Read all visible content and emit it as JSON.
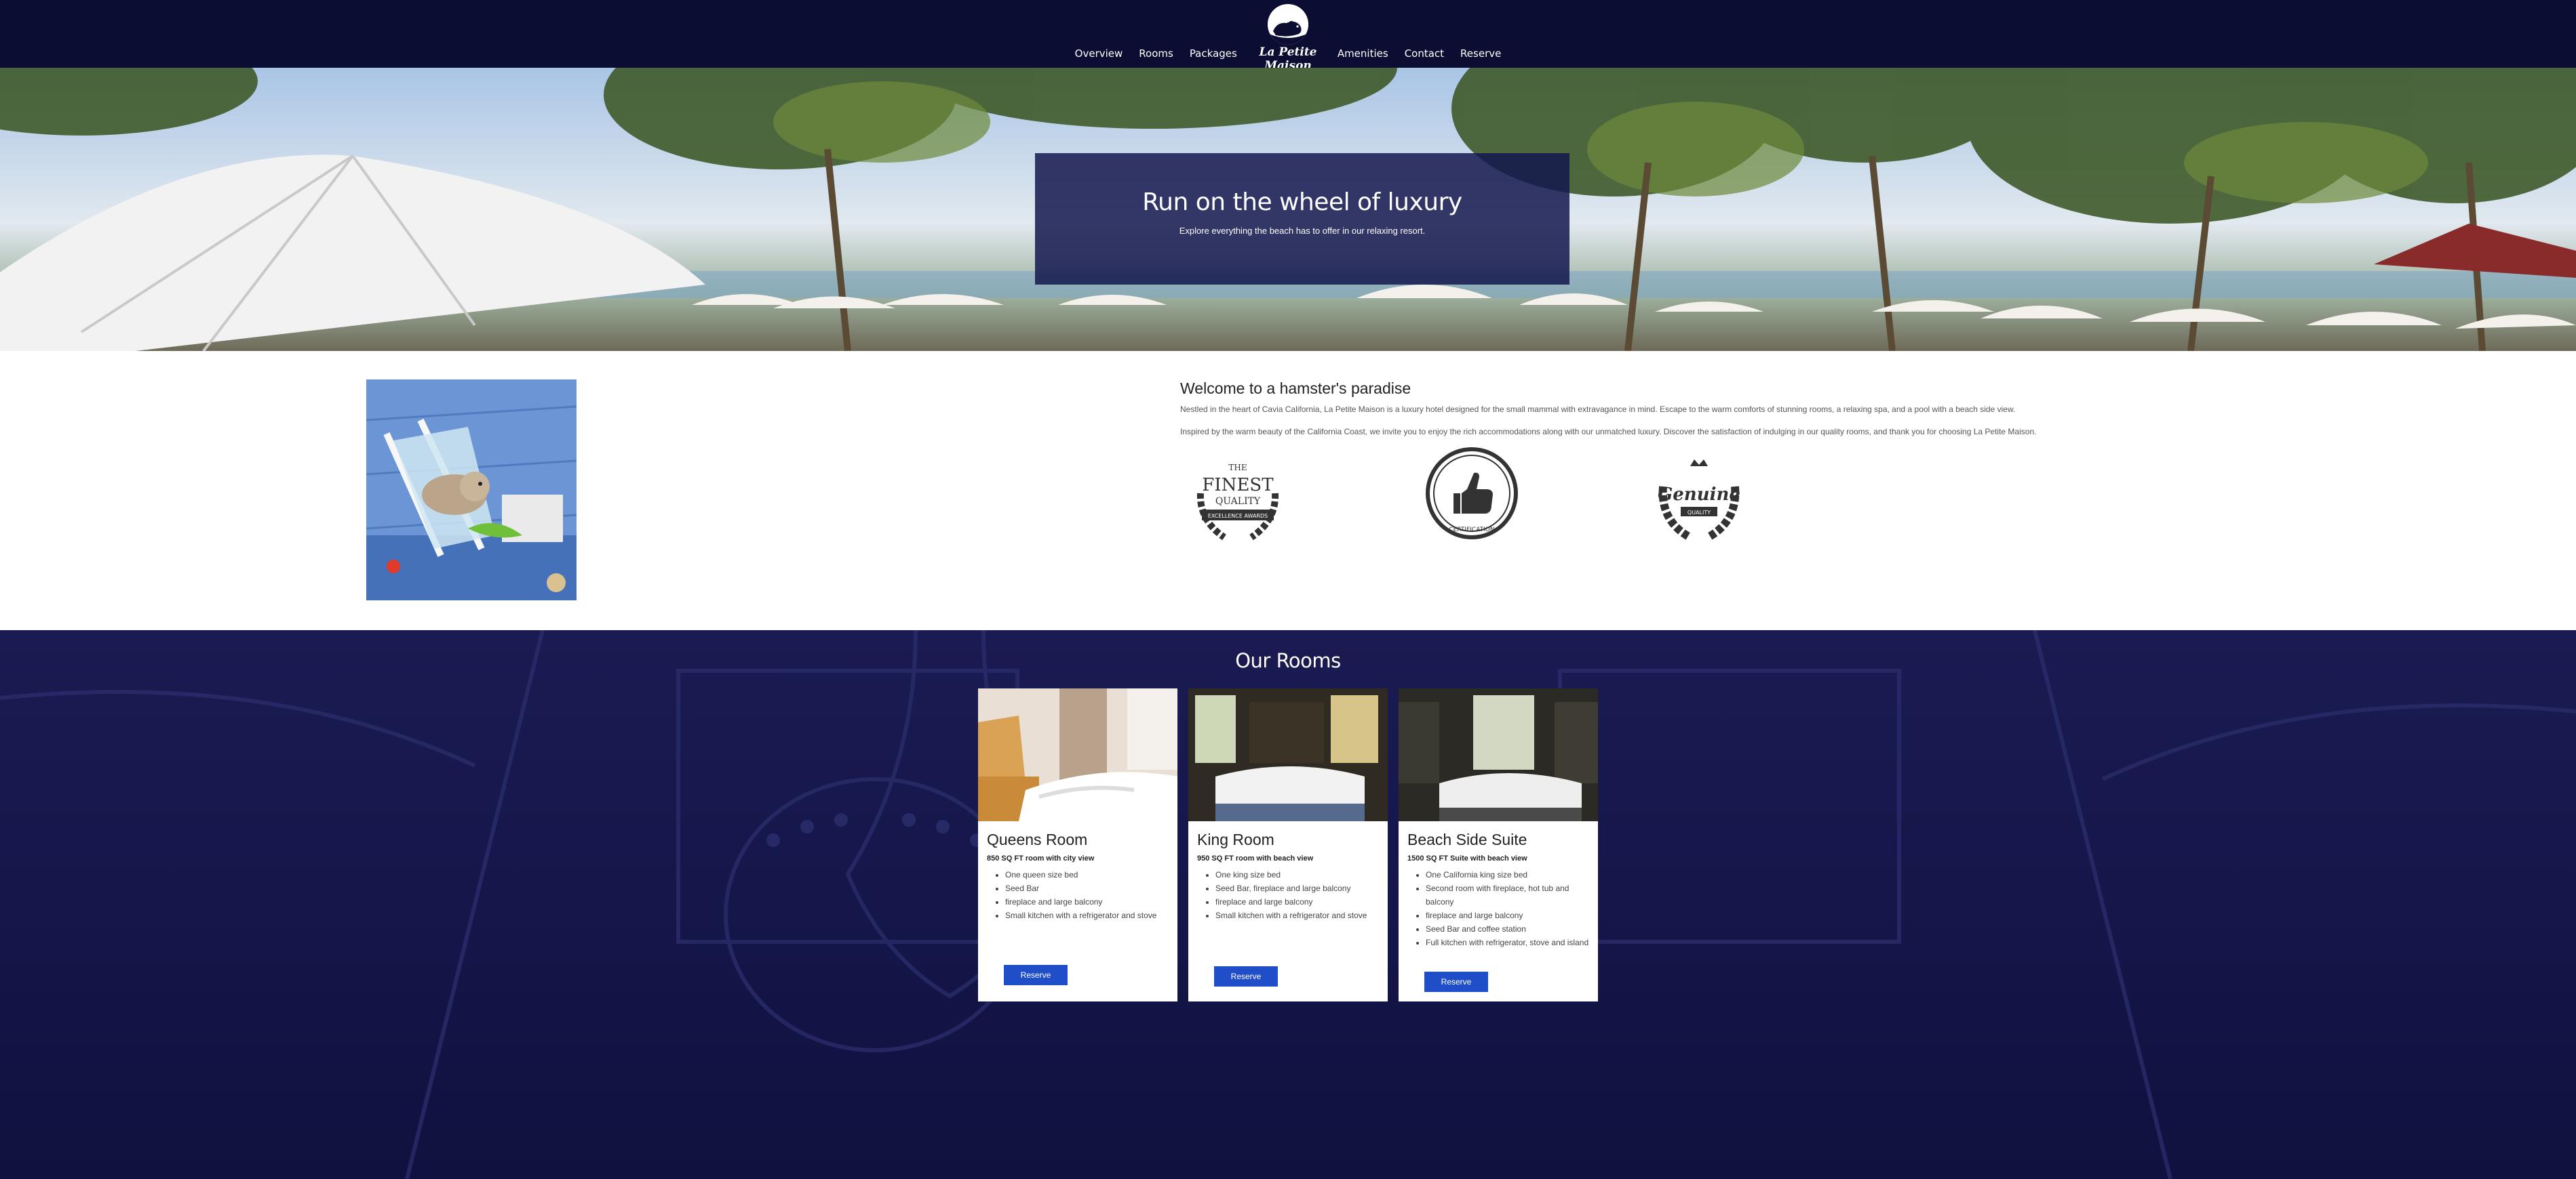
{
  "nav": {
    "items": [
      {
        "label": "Overview"
      },
      {
        "label": "Rooms"
      },
      {
        "label": "Packages"
      },
      {
        "label": "Amenities"
      },
      {
        "label": "Contact"
      },
      {
        "label": "Reserve"
      }
    ],
    "logo_text": "La Petite Maison"
  },
  "hero": {
    "title": "Run on the wheel of luxury",
    "subtitle": "Explore everything the beach has to offer in our relaxing resort."
  },
  "welcome": {
    "title": "Welcome to a hamster's paradise",
    "paragraph1": "Nestled in the heart of Cavia California, La Petite Maison is a luxury hotel designed for the small mammal with extravagance in mind. Escape to the warm comforts of stunning rooms, a relaxing spa, and a pool with a beach side view.",
    "paragraph2": "Inspired by the warm beauty of the California Coast, we invite you to enjoy the rich accommodations along with our unmatched luxury. Discover the satisfaction of indulging in our quality rooms, and thank you for choosing La Petite Maison.",
    "badges": [
      {
        "name": "finest-quality-badge",
        "line1": "THE",
        "line2": "FINEST",
        "line3": "QUALITY",
        "ribbon": "EXCELLENCE AWARDS"
      },
      {
        "name": "certification-badge",
        "ribbon": "CERTIFICATION"
      },
      {
        "name": "genuine-badge",
        "line1": "Genuine",
        "ribbon": "QUALITY"
      }
    ]
  },
  "rooms": {
    "title": "Our Rooms",
    "cards": [
      {
        "title": "Queens Room",
        "subtitle": "850 SQ FT room with city view",
        "features": [
          "One queen size bed",
          "Seed Bar",
          "fireplace and large balcony",
          "Small kitchen with a refrigerator and stove"
        ],
        "button": "Reserve"
      },
      {
        "title": "King Room",
        "subtitle": "950 SQ FT room with beach view",
        "features": [
          "One king size bed",
          "Seed Bar, fireplace and large balcony",
          "fireplace and large balcony",
          "Small kitchen with a refrigerator and stove"
        ],
        "button": "Reserve"
      },
      {
        "title": "Beach Side Suite",
        "subtitle": "1500 SQ FT Suite with beach view",
        "features": [
          "One California king size bed",
          "Second room with fireplace, hot tub and balcony",
          "fireplace and large balcony",
          "Seed Bar and coffee station",
          "Full kitchen with refrigerator, stove and island"
        ],
        "button": "Reserve"
      }
    ]
  },
  "colors": {
    "nav_bg": "#0b0d33",
    "hero_box": "#14184e",
    "rooms_bg": "#15164a",
    "button": "#1f4ec8"
  }
}
